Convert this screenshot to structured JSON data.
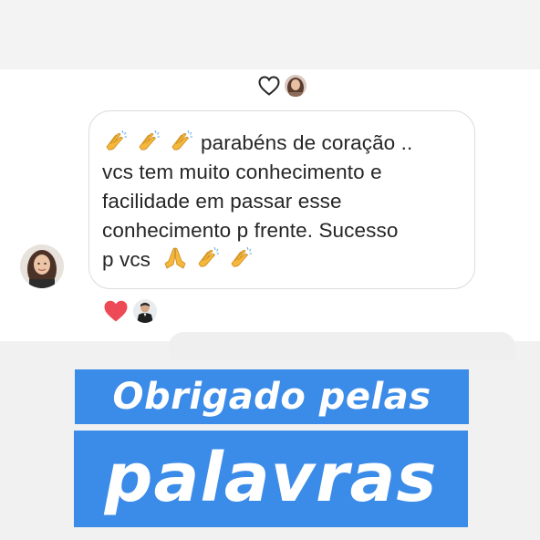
{
  "story": {
    "message": {
      "lines": [
        "parabéns de coração ..",
        "vcs tem muito conhecimento e",
        "facilidade em passar esse",
        "conhecimento p frente. Sucesso",
        "p vcs"
      ],
      "leading_emojis": [
        "clapping-hands",
        "clapping-hands",
        "clapping-hands"
      ],
      "trailing_emojis": [
        "folded-hands",
        "clapping-hands",
        "clapping-hands"
      ]
    },
    "top_reaction": {
      "icon": "heart-outline-icon"
    },
    "bottom_reaction": {
      "icon": "heart-filled-icon",
      "color": "#ed4956"
    },
    "captions": {
      "line1": "Obrigado pelas",
      "line2": "palavras",
      "background": "#3b8be8",
      "text_color": "#ffffff"
    }
  }
}
